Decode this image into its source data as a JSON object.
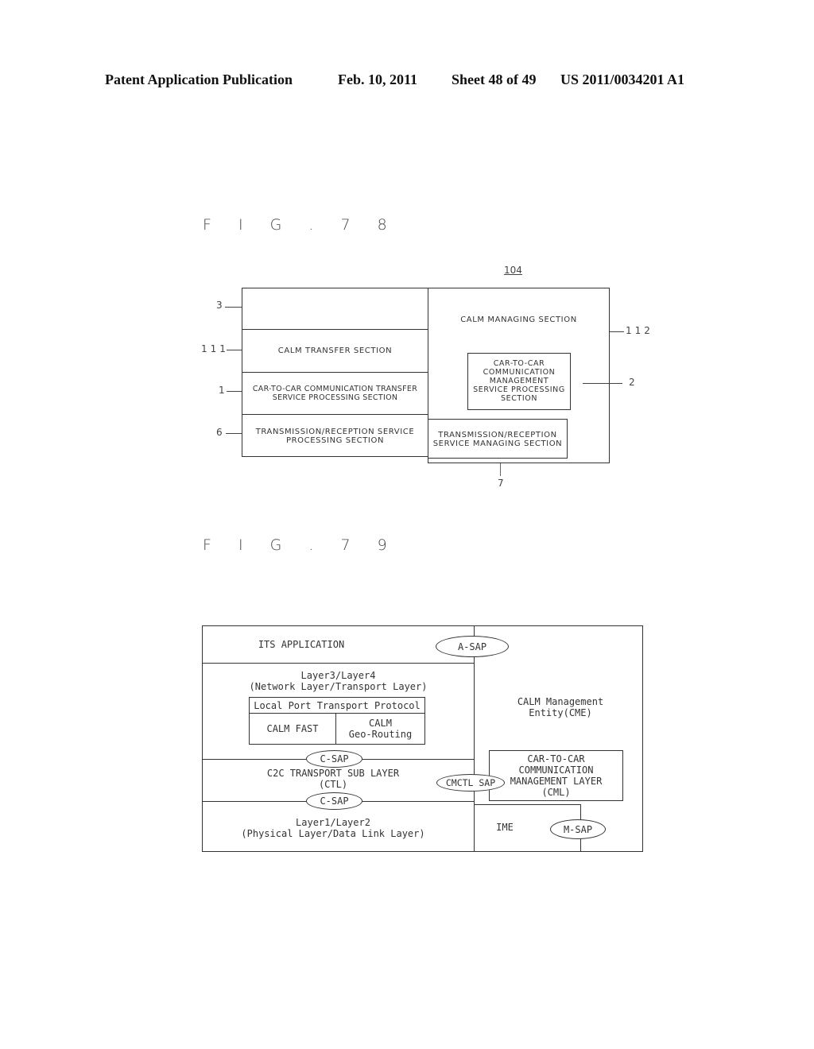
{
  "header": {
    "publication": "Patent Application Publication",
    "date": "Feb. 10, 2011",
    "sheet": "Sheet 48 of 49",
    "number": "US 2011/0034201 A1"
  },
  "fig78": {
    "label": "F I G . 7 8",
    "ref_main": "104",
    "blocks": {
      "block3": "",
      "calm_transfer": "CALM TRANSFER SECTION",
      "c2c_transfer": "CAR-TO-CAR COMMUNICATION TRANSFER\nSERVICE PROCESSING SECTION",
      "txrx_processing": "TRANSMISSION/RECEPTION SERVICE\nPROCESSING SECTION",
      "calm_managing": "CALM MANAGING SECTION",
      "c2c_management": "CAR-TO-CAR\nCOMMUNICATION\nMANAGEMENT\nSERVICE PROCESSING\nSECTION",
      "txrx_managing": "TRANSMISSION/RECEPTION\nSERVICE MANAGING SECTION"
    },
    "refs": {
      "r3": "3",
      "r111": "111",
      "r1": "1",
      "r6": "6",
      "r112": "112",
      "r2": "2",
      "r7": "7"
    }
  },
  "fig79": {
    "label": "F I G . 7 9",
    "blocks": {
      "its_app": "ITS APPLICATION",
      "layer34": "Layer3/Layer4\n(Network Layer/Transport Layer)",
      "lptp": "Local Port Transport Protocol",
      "calm_fast": "CALM FAST",
      "geo_routing": "CALM\nGeo-Routing",
      "c2c_transport": "C2C TRANSPORT SUB LAYER\n(CTL)",
      "layer12": "Layer1/Layer2\n(Physical Layer/Data Link Layer)",
      "cme": "CALM Management\nEntity(CME)",
      "cml": "CAR-TO-CAR\nCOMMUNICATION\nMANAGEMENT LAYER\n(CML)",
      "ime": "IME"
    },
    "saps": {
      "a_sap": "A-SAP",
      "c_sap_upper": "C-SAP",
      "c_sap_lower": "C-SAP",
      "cmctl_sap": "CMCTL SAP",
      "m_sap": "M-SAP"
    }
  }
}
